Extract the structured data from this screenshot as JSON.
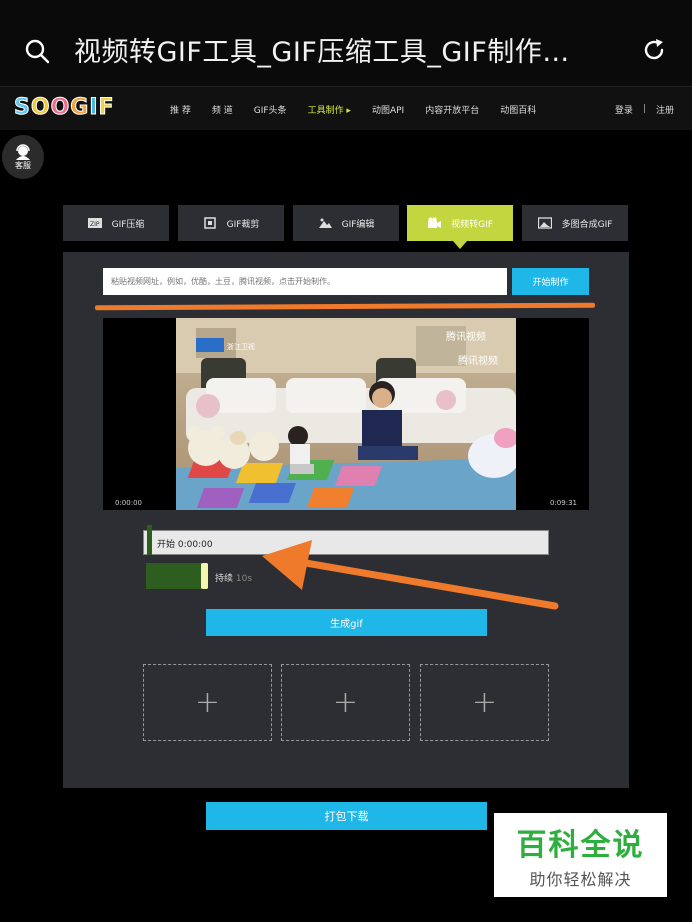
{
  "browser": {
    "title": "视频转GIF工具_GIF压缩工具_GIF制作…"
  },
  "site": {
    "logo": "SOOGIF",
    "logo_colors": [
      "#5ec4f0",
      "#f0c93a",
      "#f06a8c",
      "#f2a23a",
      "#4ab8d8",
      "#f0d040"
    ],
    "nav": [
      "推 荐",
      "频 道",
      "GIF头条",
      "工具制作",
      "动图API",
      "内容开放平台",
      "动图百科"
    ],
    "active_nav": "工具制作",
    "login": "登录",
    "separator": "|",
    "register": "注册"
  },
  "customer_service": {
    "label": "客服"
  },
  "tabs": [
    {
      "label": "GIF压缩",
      "icon": "zip-icon"
    },
    {
      "label": "GIF裁剪",
      "icon": "crop-icon"
    },
    {
      "label": "GIF编辑",
      "icon": "image-edit-icon"
    },
    {
      "label": "视频转GIF",
      "icon": "video-camera-icon",
      "active": true
    },
    {
      "label": "多图合成GIF",
      "icon": "multi-image-icon"
    }
  ],
  "url_input": {
    "placeholder": "粘贴视频网址，例如，优酷，土豆，腾讯视频，点击开始制作。",
    "value": ""
  },
  "start_button": "开始制作",
  "video": {
    "current_time": "0:00:00",
    "total_time": "0:09:31",
    "watermark_left": "浙江卫视",
    "watermark_right_1": "腾讯视频",
    "watermark_right_2": "腾讯视频"
  },
  "timeline": {
    "start_label": "开始 0:00:00",
    "duration_label": "持续",
    "duration_value": "10s"
  },
  "generate_button": "生成gif",
  "slots": [
    "+",
    "+",
    "+"
  ],
  "download_button": "打包下载",
  "watermark": {
    "title": "百科全说",
    "subtitle": "助你轻松解决"
  },
  "colors": {
    "accent_blue": "#1fb6e8",
    "active_tab": "#c3d640",
    "arrow_orange": "#f07a2b",
    "panel": "#2d2e33"
  }
}
